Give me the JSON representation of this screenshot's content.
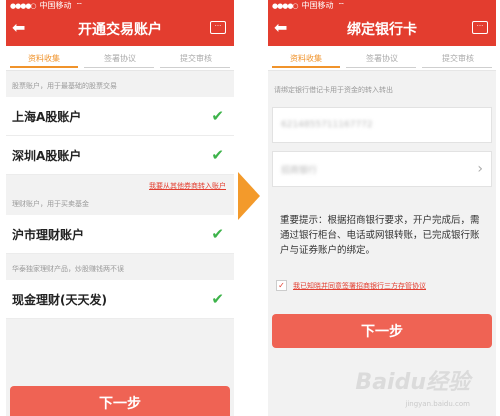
{
  "left": {
    "status": {
      "carrier": "中国移动",
      "signal": "●●●●○"
    },
    "nav": {
      "title": "开通交易账户"
    },
    "tabs": [
      "资料收集",
      "签署协议",
      "提交审核"
    ],
    "stock_hint": "股票账户，用于最基础的股票交易",
    "rows": [
      "上海A股账户",
      "深圳A股账户"
    ],
    "transfer_link": "我要从其他券商转入账户",
    "fund_hint": "理财账户，用于买卖基金",
    "fund_row": "沪市理财账户",
    "product_hint": "华泰独家理财产品，炒股赚钱两不误",
    "cash_row": "现金理财(天天发)",
    "next_button": "下一步"
  },
  "right": {
    "status": {
      "carrier": "中国移动",
      "signal": "●●●●○"
    },
    "nav": {
      "title": "绑定银行卡"
    },
    "tabs": [
      "资料收集",
      "签署协议",
      "提交审核"
    ],
    "hint": "请绑定银行借记卡用于资金的转入转出",
    "card_number": "6214855711167772",
    "bank_name": "招商银行",
    "notice": "重要提示：根据招商银行要求，开户完成后，需通过银行柜台、电话或网银转账，已完成银行账户与证券账户的绑定。",
    "agreement": "我已知晓并同意签署招商银行三方存管协议",
    "next_button": "下一步"
  },
  "watermark": "Baidu经验",
  "watermark_sub": "jingyan.baidu.com",
  "colors": {
    "accent_red": "#e33d2f",
    "tab_orange": "#f0932b",
    "check_green": "#3db34a",
    "arrow_orange": "#f39a2b",
    "button": "#ef6354"
  }
}
